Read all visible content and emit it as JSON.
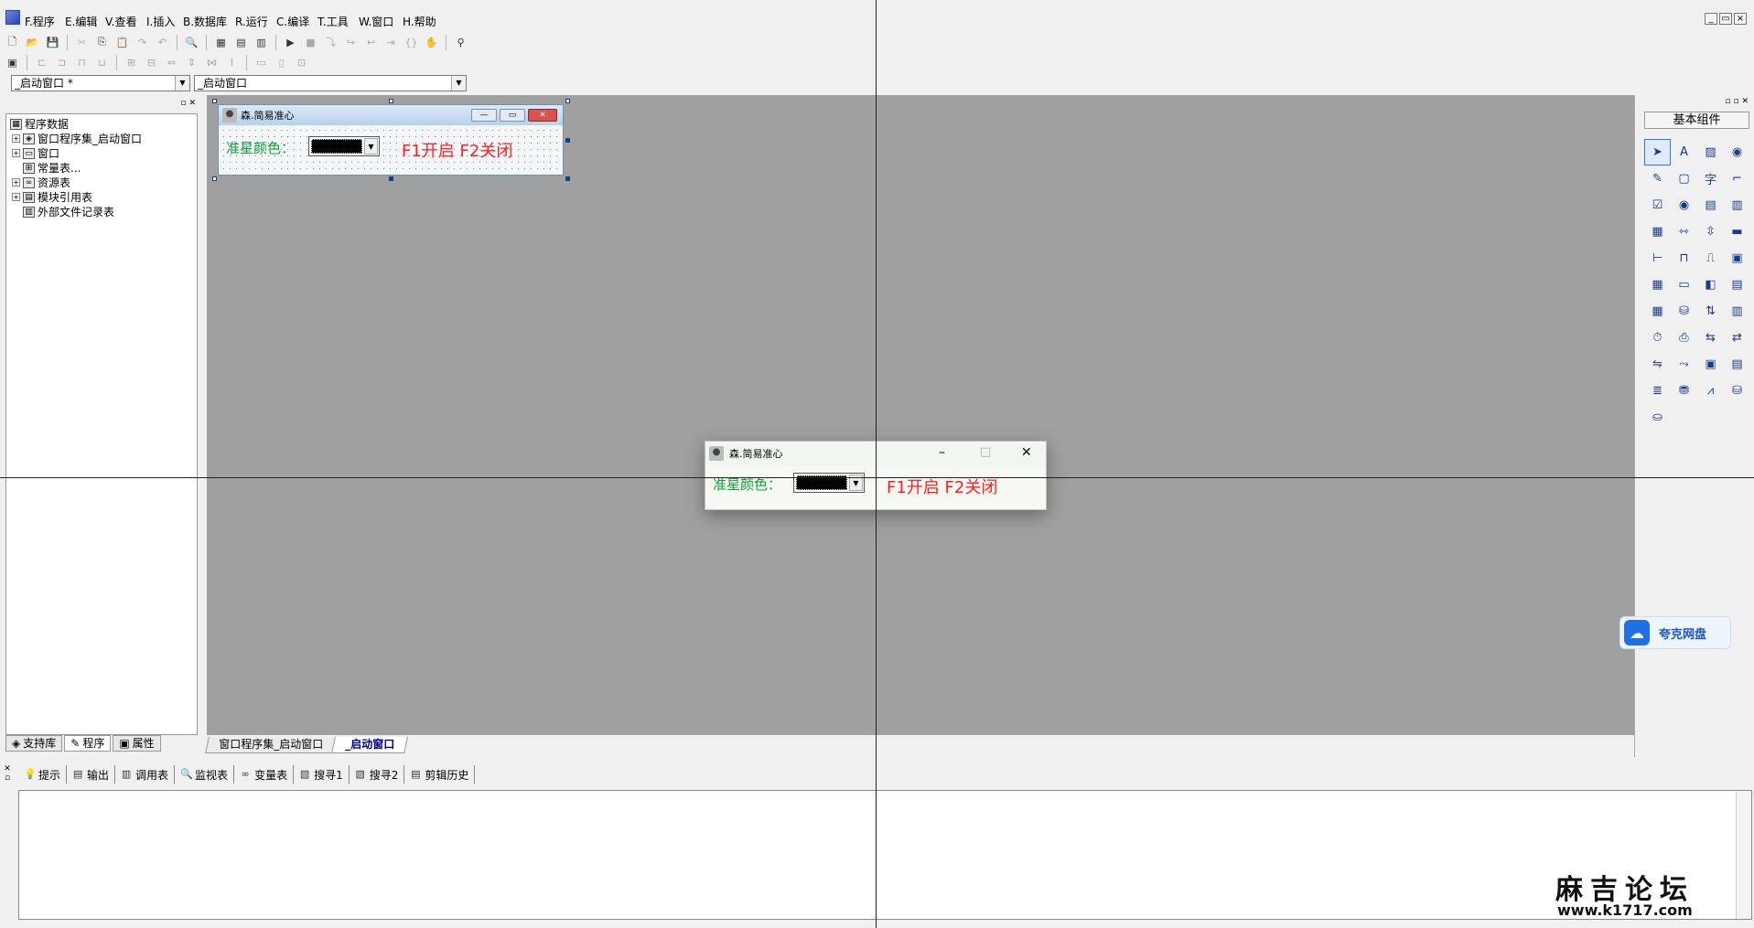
{
  "menu": [
    "F.程序",
    "E.编辑",
    "V.查看",
    "I.插入",
    "B.数据库",
    "R.运行",
    "C.编译",
    "T.工具",
    "W.窗口",
    "H.帮助"
  ],
  "window_controls": [
    "_",
    "▭",
    "×"
  ],
  "combos": {
    "left": "_启动窗口 *",
    "right": "_启动窗口"
  },
  "tree": {
    "root": "程序数据",
    "items": [
      "窗口程序集_启动窗口",
      "窗口",
      "常量表...",
      "资源表",
      "模块引用表",
      "外部文件记录表"
    ]
  },
  "left_tabs": [
    "支持库",
    "程序",
    "属性"
  ],
  "design_form": {
    "title": "森.简易准心",
    "label": "准星颜色：",
    "hotkeys": "F1开启 F2关闭"
  },
  "run_window": {
    "title": "森.简易准心",
    "label": "准星颜色：",
    "hotkeys": "F1开启 F2关闭",
    "controls": [
      "–",
      "□",
      "✕"
    ]
  },
  "doc_tabs": [
    "窗口程序集_启动窗口",
    "_启动窗口"
  ],
  "components": {
    "header": "基本组件"
  },
  "cloud": {
    "label": "夸克网盘"
  },
  "output_tabs": [
    {
      "icon": "💡",
      "label": "提示"
    },
    {
      "icon": "▤",
      "label": "输出"
    },
    {
      "icon": "▥",
      "label": "调用表"
    },
    {
      "icon": "🔍",
      "label": "监视表"
    },
    {
      "icon": "∞",
      "label": "变量表"
    },
    {
      "icon": "▧",
      "label": "搜寻1"
    },
    {
      "icon": "▧",
      "label": "搜寻2"
    },
    {
      "icon": "▤",
      "label": "剪辑历史"
    }
  ],
  "watermark": {
    "title": "麻吉论坛",
    "url": "www.k1717.com"
  },
  "colors": {
    "accent_green": "#11a034",
    "hotkey_red": "#ff2020",
    "design_bg": "#a0a0a0"
  }
}
